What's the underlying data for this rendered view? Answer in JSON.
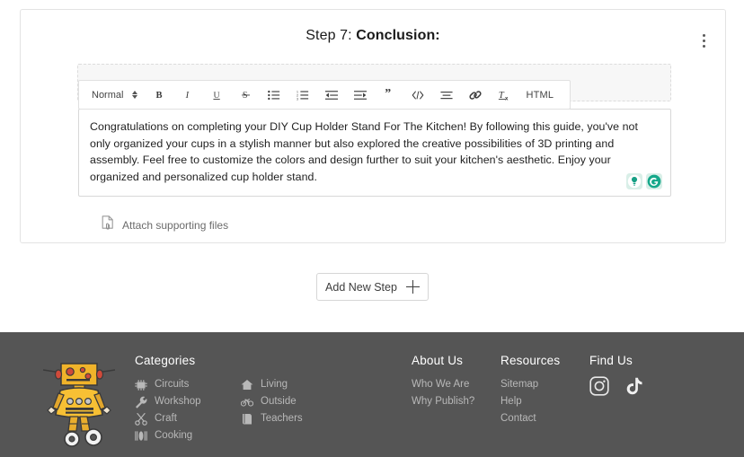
{
  "step": {
    "number_label": "Step 7:",
    "title_label": "Conclusion:",
    "menu_icon": "kebab-menu-icon"
  },
  "editor": {
    "format_select_value": "Normal",
    "toolbar_buttons": [
      {
        "name": "bold-icon",
        "label": "B"
      },
      {
        "name": "italic-icon",
        "label": "I"
      },
      {
        "name": "underline-icon",
        "label": "U"
      },
      {
        "name": "strikethrough-icon",
        "label": "S"
      },
      {
        "name": "bulleted-list-icon",
        "label": ""
      },
      {
        "name": "numbered-list-icon",
        "label": ""
      },
      {
        "name": "outdent-icon",
        "label": ""
      },
      {
        "name": "indent-icon",
        "label": ""
      },
      {
        "name": "blockquote-icon",
        "label": "”"
      },
      {
        "name": "code-icon",
        "label": ""
      },
      {
        "name": "align-icon",
        "label": ""
      },
      {
        "name": "link-icon",
        "label": ""
      },
      {
        "name": "clear-format-icon",
        "label": ""
      }
    ],
    "html_button_label": "HTML",
    "body_text": "Congratulations on completing your DIY Cup Holder Stand For The Kitchen! By following this guide, you've not only organized your cups in a stylish manner but also explored the creative possibilities of 3D printing and assembly. Feel free to customize the colors and design further to suit your kitchen's aesthetic. Enjoy your organized and personalized cup holder stand.",
    "assistant_badges": [
      {
        "name": "grammarly-suggestion-icon",
        "color": "#15a88a"
      },
      {
        "name": "grammarly-logo-icon",
        "color": "#15a88a"
      }
    ],
    "attach_label": "Attach supporting files",
    "attach_icon": "attach-file-icon"
  },
  "actions": {
    "add_step_label": "Add New Step",
    "add_step_icon": "plus-icon"
  },
  "footer": {
    "background_color": "#555555",
    "mascot_icon": "instructables-robot-mascot",
    "categories": {
      "title": "Categories",
      "items": [
        {
          "label": "Circuits",
          "icon": "circuit-chip-icon"
        },
        {
          "label": "Living",
          "icon": "house-icon"
        },
        {
          "label": "Workshop",
          "icon": "wrench-icon"
        },
        {
          "label": "Outside",
          "icon": "bicycle-icon"
        },
        {
          "label": "Craft",
          "icon": "scissors-icon"
        },
        {
          "label": "Teachers",
          "icon": "book-icon"
        },
        {
          "label": "Cooking",
          "icon": "cutlery-icon"
        }
      ]
    },
    "about": {
      "title": "About Us",
      "items": [
        {
          "label": "Who We Are"
        },
        {
          "label": "Why Publish?"
        }
      ]
    },
    "resources": {
      "title": "Resources",
      "items": [
        {
          "label": "Sitemap"
        },
        {
          "label": "Help"
        },
        {
          "label": "Contact"
        }
      ]
    },
    "find_us": {
      "title": "Find Us",
      "socials": [
        {
          "name": "instagram-icon"
        },
        {
          "name": "tiktok-icon"
        }
      ]
    }
  }
}
